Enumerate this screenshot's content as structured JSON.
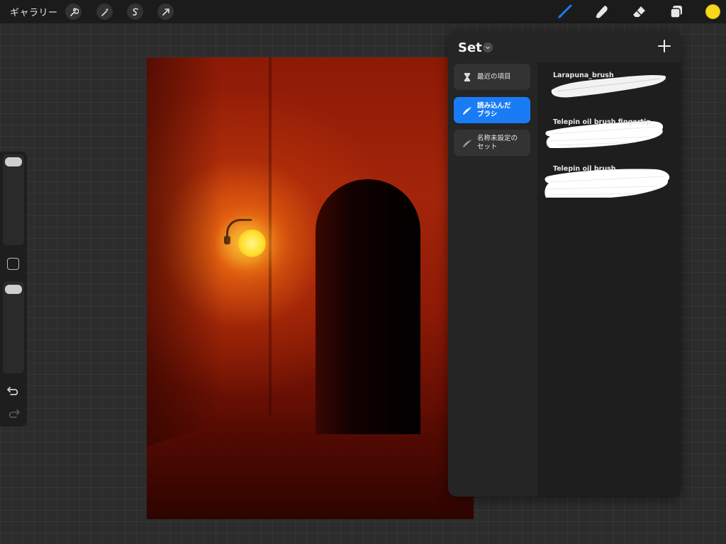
{
  "topbar": {
    "gallery_label": "ギャラリー",
    "left_tools": [
      {
        "name": "wrench-icon"
      },
      {
        "name": "magic-wand-icon"
      },
      {
        "name": "selection-icon"
      },
      {
        "name": "transform-arrow-icon"
      }
    ],
    "right_tools": [
      {
        "name": "brush-icon",
        "color": "#1a7cf5"
      },
      {
        "name": "smudge-icon",
        "color": "#e6e6e6"
      },
      {
        "name": "eraser-icon",
        "color": "#e6e6e6"
      },
      {
        "name": "layers-icon",
        "color": "#e6e6e6"
      }
    ],
    "current_color": "#f9d71c"
  },
  "sidebar": {
    "size_slider_level": 0.9,
    "opacity_slider_level": 0.9,
    "modify_button": "square-icon",
    "undo": "undo-icon",
    "redo": "redo-icon"
  },
  "brush_library": {
    "title": "Set",
    "add_icon": "plus-icon",
    "sets": [
      {
        "label_line1": "最近の項目",
        "label_line2": "",
        "icon": "hourglass-icon",
        "active": false
      },
      {
        "label_line1": "読み込んだ",
        "label_line2": "ブラシ",
        "icon": "brush-stroke-icon",
        "active": true
      },
      {
        "label_line1": "名称未設定の",
        "label_line2": "セット",
        "icon": "brush-stroke-icon",
        "active": false
      }
    ],
    "brushes": [
      {
        "name": "Larapuna_brush"
      },
      {
        "name": "Telepin oil brush fingertip"
      },
      {
        "name": "Telepin oil brush"
      }
    ]
  }
}
